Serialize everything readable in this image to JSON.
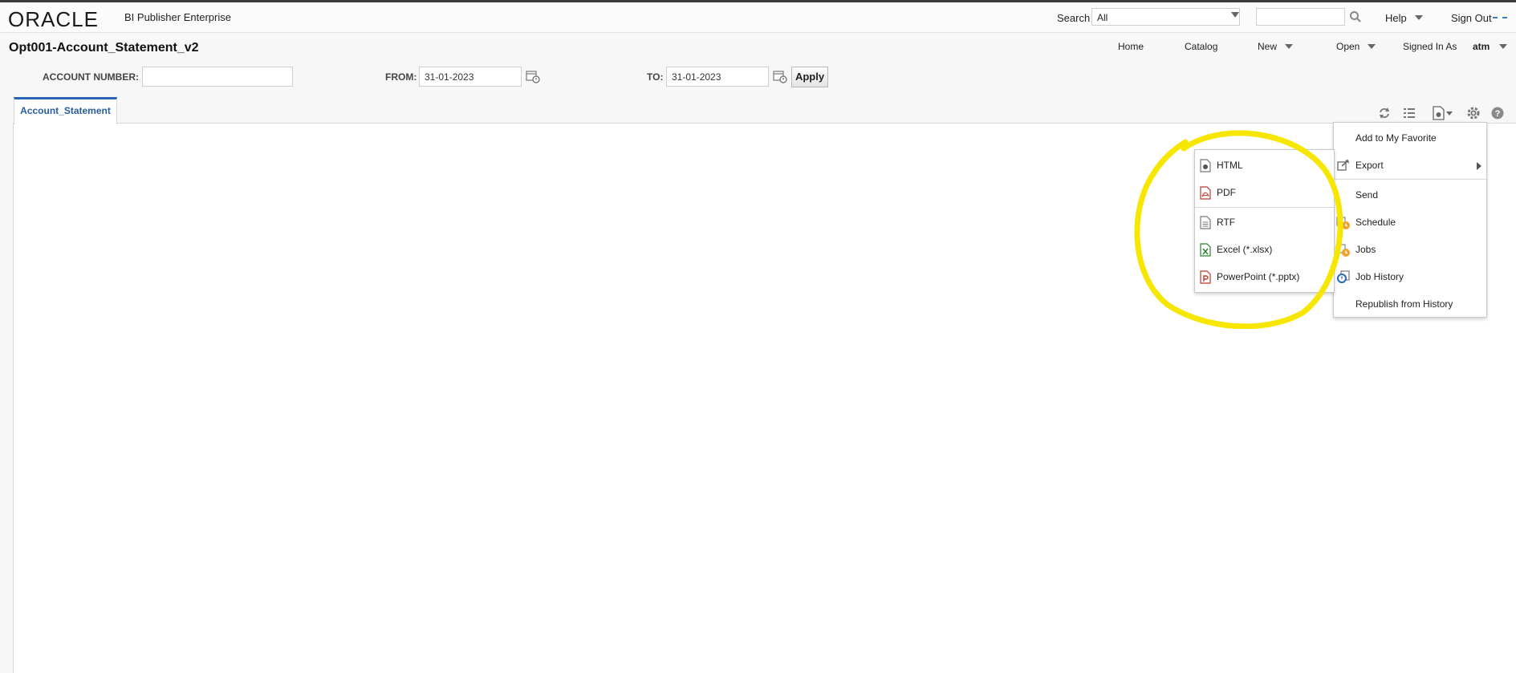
{
  "header": {
    "logo": "ORACLE",
    "product_name": "BI Publisher Enterprise",
    "search_label": "Search",
    "search_scope": "All",
    "search_value": "",
    "help": "Help",
    "sign_out": "Sign Out"
  },
  "nav": {
    "home": "Home",
    "catalog": "Catalog",
    "new": "New",
    "open": "Open",
    "signed_in_as": "Signed In As",
    "user": "atm"
  },
  "report": {
    "title": "Opt001-Account_Statement_v2"
  },
  "params": {
    "account_label": "ACCOUNT NUMBER:",
    "account_value": "",
    "from_label": "FROM:",
    "from_value": "31-01-2023",
    "to_label": "TO:",
    "to_value": "31-01-2023",
    "apply": "Apply"
  },
  "tabs": [
    {
      "label": "Account_Statement"
    }
  ],
  "actions_menu": {
    "items": [
      {
        "label": "Add to My Favorite",
        "icon": ""
      },
      {
        "label": "Export",
        "icon": "export-icon"
      },
      {
        "label": "Send",
        "icon": ""
      },
      {
        "label": "Schedule",
        "icon": "schedule-icon"
      },
      {
        "label": "Jobs",
        "icon": "jobs-icon"
      },
      {
        "label": "Job History",
        "icon": "job-history-icon"
      },
      {
        "label": "Republish from History",
        "icon": ""
      }
    ]
  },
  "export_menu": {
    "items": [
      {
        "label": "HTML",
        "icon": "html-file-icon"
      },
      {
        "label": "PDF",
        "icon": "pdf-file-icon"
      },
      {
        "label": "RTF",
        "icon": "rtf-file-icon"
      },
      {
        "label": "Excel (*.xlsx)",
        "icon": "excel-file-icon"
      },
      {
        "label": "PowerPoint (*.pptx)",
        "icon": "powerpoint-file-icon"
      }
    ]
  },
  "colors": {
    "tab_accent": "#2a67b2",
    "highlight_circle": "#f7e600"
  }
}
